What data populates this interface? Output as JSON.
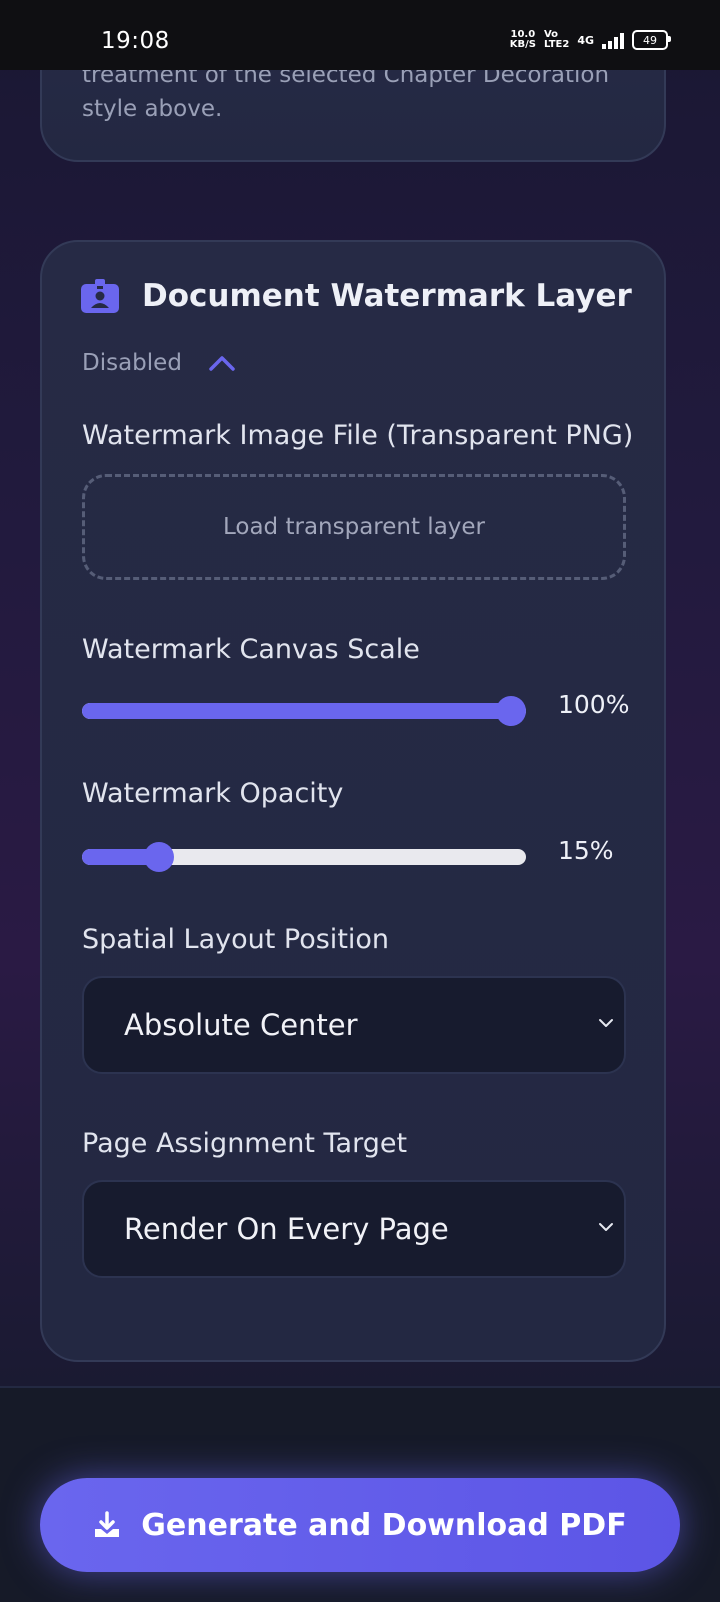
{
  "status_bar": {
    "time": "19:08",
    "net_speed_value": "10.0",
    "net_speed_unit": "KB/S",
    "volte_top": "Vo",
    "volte_bottom": "LTE2",
    "network": "4G",
    "battery": "49"
  },
  "top_card": {
    "description": "treatment of the selected Chapter Decoration style above."
  },
  "watermark_card": {
    "title": "Document Watermark Layer",
    "status": "Disabled",
    "icon": "badge-icon",
    "image_file": {
      "label": "Watermark Image File (Transparent PNG)",
      "placeholder": "Load transparent layer"
    },
    "scale": {
      "label": "Watermark Canvas Scale",
      "value_text": "100%",
      "value": 100
    },
    "opacity": {
      "label": "Watermark Opacity",
      "value_text": "15%",
      "value": 15
    },
    "position": {
      "label": "Spatial Layout Position",
      "selected": "Absolute Center"
    },
    "page_target": {
      "label": "Page Assignment Target",
      "selected": "Render On Every Page"
    }
  },
  "footer": {
    "generate_label": "Generate and Download PDF"
  },
  "colors": {
    "accent": "#6a66ee",
    "card_bg": "#262a45",
    "select_bg": "#171b2e"
  }
}
